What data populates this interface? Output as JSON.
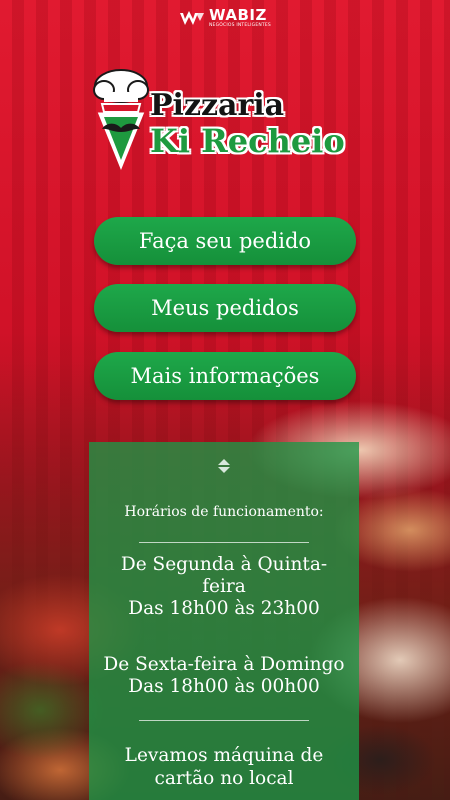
{
  "brand": {
    "name": "WABIZ",
    "tagline": "NEGÓCIOS INTELIGENTES"
  },
  "logo": {
    "line1": "Pizzaria",
    "line2": "Ki Recheio"
  },
  "menu": {
    "order": "Faça seu pedido",
    "my_orders": "Meus pedidos",
    "more_info": "Mais informações"
  },
  "info": {
    "heading": "Horários de funcionamento:",
    "block1_days": "De Segunda à Quinta-feira",
    "block1_hours": "Das 18h00 às 23h00",
    "block2_days": "De Sexta-feira à Domingo",
    "block2_hours": "Das 18h00 às 00h00",
    "note": "Levamos máquina de cartão no local"
  },
  "colors": {
    "background_red": "#d7162b",
    "button_green": "#1ea84a",
    "panel_green": "#1e9646",
    "logo_green": "#1e9a3f"
  }
}
